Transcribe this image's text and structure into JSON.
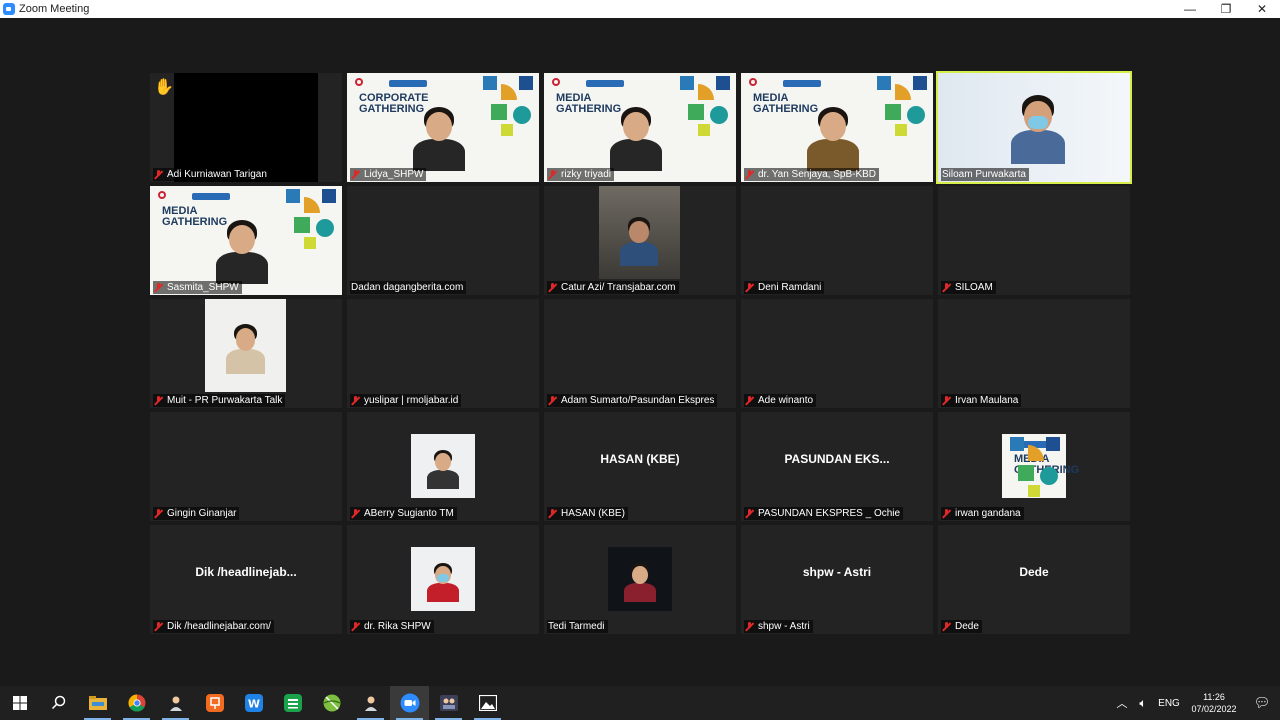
{
  "window": {
    "title": "Zoom Meeting",
    "controls": [
      "minimize-icon",
      "maximize-icon",
      "close-icon"
    ]
  },
  "participants": [
    {
      "name": "Adi Kurniawan Tarigan",
      "muted": true,
      "hand_raised": true,
      "video": "black"
    },
    {
      "name": "Lidya_SHPW",
      "muted": true,
      "video": "slide",
      "slide_title": "CORPORATE\nGATHERING"
    },
    {
      "name": "rizky triyadi",
      "muted": true,
      "video": "slide",
      "slide_title": "MEDIA\nGATHERING"
    },
    {
      "name": "dr. Yan Senjaya, SpB-KBD",
      "muted": true,
      "video": "slide",
      "slide_title": "MEDIA\nGATHERING"
    },
    {
      "name": "Siloam Purwakarta",
      "muted": false,
      "active_speaker": true,
      "video": "camera"
    },
    {
      "name": "Sasmita_SHPW",
      "muted": true,
      "video": "slide",
      "slide_title": "MEDIA\nGATHERING"
    },
    {
      "name": "Dadan dagangberita.com",
      "muted": false,
      "video": "off"
    },
    {
      "name": "Catur Azi/ Transjabar.com",
      "muted": true,
      "video": "camera"
    },
    {
      "name": "Deni Ramdani",
      "muted": true,
      "video": "off"
    },
    {
      "name": "SILOAM",
      "muted": true,
      "video": "off"
    },
    {
      "name": "Muit - PR Purwakarta Talk",
      "muted": true,
      "video": "photo"
    },
    {
      "name": "yuslipar | rmoljabar.id",
      "muted": true,
      "video": "off"
    },
    {
      "name": "Adam Sumarto/Pasundan Ekspres",
      "muted": true,
      "video": "off"
    },
    {
      "name": "Ade winanto",
      "muted": true,
      "video": "off"
    },
    {
      "name": "Irvan Maulana",
      "muted": true,
      "video": "off"
    },
    {
      "name": "Gingin Ginanjar",
      "muted": true,
      "video": "off"
    },
    {
      "name": "ABerry Sugianto TM",
      "muted": true,
      "video": "photo"
    },
    {
      "name": "HASAN (KBE)",
      "muted": true,
      "video": "name",
      "display": "HASAN (KBE)"
    },
    {
      "name": "PASUNDAN EKSPRES _ Ochie",
      "muted": true,
      "video": "name",
      "display": "PASUNDAN  EKS..."
    },
    {
      "name": "irwan gandana",
      "muted": true,
      "video": "photo-slide",
      "slide_title": "MEDIA\nGATHERING"
    },
    {
      "name": "Dik /headlinejabar.com/",
      "muted": true,
      "video": "name",
      "display": "Dik  /headlinejab..."
    },
    {
      "name": "dr. Rika SHPW",
      "muted": true,
      "video": "photo"
    },
    {
      "name": "Tedi Tarmedi",
      "muted": false,
      "video": "photo"
    },
    {
      "name": "shpw - Astri",
      "muted": true,
      "video": "name",
      "display": "shpw - Astri"
    },
    {
      "name": "Dede",
      "muted": true,
      "video": "name",
      "display": "Dede"
    }
  ],
  "taskbar": {
    "apps": [
      "windows-start-icon",
      "search-icon",
      "file-explorer-icon",
      "chrome-icon",
      "user-app-icon",
      "slides-app-icon",
      "writer-app-icon",
      "sheets-app-icon",
      "ball-app-icon",
      "user-app-2-icon",
      "zoom-icon",
      "photo-app-icon",
      "photos-icon"
    ],
    "language": "ENG",
    "time": "11:26",
    "date": "07/02/2022"
  }
}
